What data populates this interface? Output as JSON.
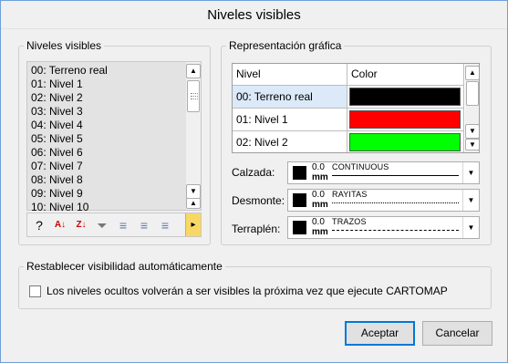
{
  "window": {
    "title": "Niveles visibles"
  },
  "left_group": {
    "legend": "Niveles visibles",
    "items": [
      "00: Terreno real",
      "01: Nivel 1",
      "02: Nivel 2",
      "03: Nivel 3",
      "04: Nivel 4",
      "05: Nivel 5",
      "06: Nivel 6",
      "07: Nivel 7",
      "08: Nivel 8",
      "09: Nivel 9",
      "10: Nivel 10"
    ]
  },
  "toolbar": {
    "icons": [
      "search-icon",
      "sort-ascending-icon",
      "sort-descending-icon",
      "filter-icon",
      "toggle-levels-icon-1",
      "toggle-levels-icon-2",
      "toggle-levels-icon-3",
      "more-icon"
    ],
    "glyphs": [
      "?",
      "A↓",
      "Z↓",
      "⏷",
      "≡",
      "≡",
      "≡",
      "▸"
    ]
  },
  "right_group": {
    "legend": "Representación gráfica",
    "grid": {
      "headers": [
        "Nivel",
        "Color"
      ],
      "rows": [
        {
          "nivel": "00: Terreno real",
          "color": "#000000"
        },
        {
          "nivel": "01: Nivel 1",
          "color": "#ff0000"
        },
        {
          "nivel": "02: Nivel 2",
          "color": "#00ff00"
        }
      ]
    },
    "line_styles": [
      {
        "label": "Calzada:",
        "value": "0.0",
        "unit": "mm",
        "name": "CONTINUOUS",
        "pattern": "solid"
      },
      {
        "label": "Desmonte:",
        "value": "0.0",
        "unit": "mm",
        "name": "RAYITAS",
        "pattern": "dotted"
      },
      {
        "label": "Terraplén:",
        "value": "0.0",
        "unit": "mm",
        "name": "TRAZOS",
        "pattern": "dashed"
      }
    ]
  },
  "bottom_group": {
    "legend": "Restablecer visibilidad automáticamente",
    "checkbox_label": "Los niveles ocultos volverán a ser visibles la próxima vez que ejecute CARTOMAP",
    "checked": false
  },
  "buttons": {
    "accept": "Aceptar",
    "cancel": "Cancelar"
  },
  "colors": {
    "accent": "#0078d7",
    "selection": "#dbe9f8",
    "toolbar_more": "#f7d864"
  }
}
